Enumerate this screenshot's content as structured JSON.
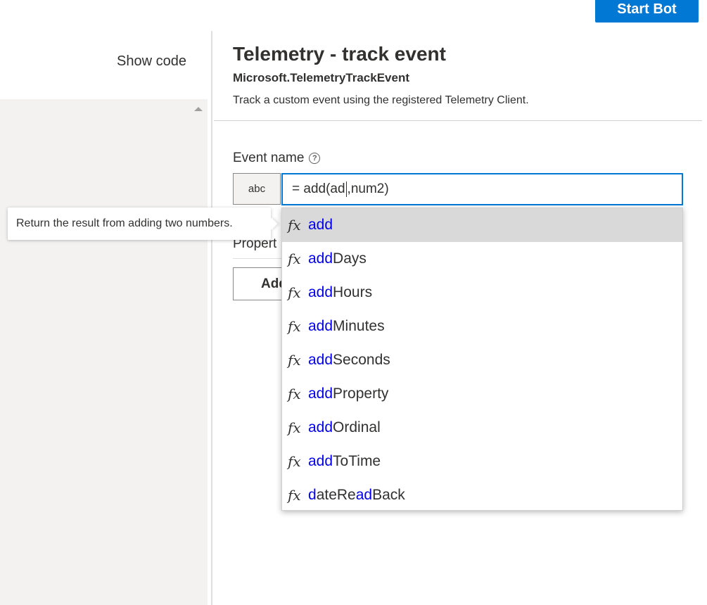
{
  "toolbar": {
    "start_bot_label": "Start Bot"
  },
  "left": {
    "show_code_label": "Show code"
  },
  "header": {
    "title": "Telemetry - track event",
    "subtitle": "Microsoft.TelemetryTrackEvent",
    "description": "Track a custom event using the registered Telemetry Client."
  },
  "form": {
    "event_name_label": "Event name",
    "help_glyph": "?",
    "type_label": "abc",
    "expr_before_caret": "= add(ad",
    "expr_after_caret": ",num2)",
    "properties_label": "Propert",
    "add_button_label": "Add"
  },
  "tooltip": {
    "text": "Return the result from adding two numbers."
  },
  "suggestions": {
    "fx_glyph": "fx",
    "items": [
      {
        "match": "add",
        "rest": "",
        "selected": true
      },
      {
        "match": "add",
        "rest": "Days"
      },
      {
        "match": "add",
        "rest": "Hours"
      },
      {
        "match": "add",
        "rest": "Minutes"
      },
      {
        "match": "add",
        "rest": "Seconds"
      },
      {
        "match": "add",
        "rest": "Property"
      },
      {
        "match": "add",
        "rest": "Ordinal"
      },
      {
        "match": "add",
        "rest": "ToTime"
      },
      {
        "prefix": "d",
        "match": "ate",
        "mid": "Re",
        "match2": "ad",
        "rest": "Back"
      }
    ]
  },
  "colors": {
    "accent": "#0078d4",
    "match_highlight": "#0000ee",
    "selected_row": "#d9d9d9"
  },
  "icons": {
    "help": "help-circle-icon",
    "function": "fx-icon",
    "scroll_up": "scroll-up-arrow-icon"
  }
}
